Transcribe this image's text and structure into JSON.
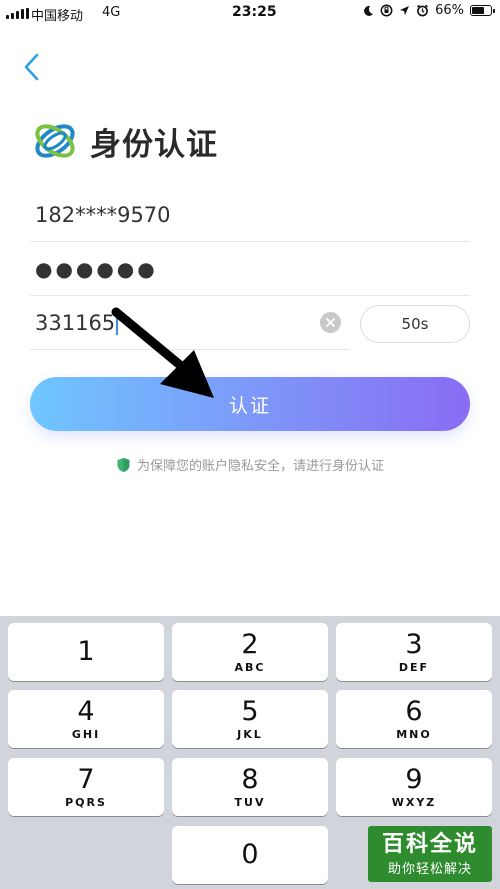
{
  "status_bar": {
    "carrier": "中国移动",
    "network": "4G",
    "time": "23:25",
    "battery_percent": "66%",
    "battery_level": 0.66,
    "icons": [
      "signal-icon",
      "moon-icon",
      "rotation-lock-icon",
      "location-icon",
      "alarm-icon",
      "battery-icon"
    ]
  },
  "nav": {
    "back_icon": "chevron-left-icon"
  },
  "header": {
    "title": "身份认证",
    "logo": "china-mobile-logo"
  },
  "form": {
    "phone_value": "182****9570",
    "password_value": "●●●●●●",
    "code_value": "331165",
    "clear_icon": "clear-icon",
    "countdown_label": "50s",
    "submit_label": "认证",
    "notice": "为保障您的账户隐私安全，请进行身份认证",
    "notice_icon": "shield-icon"
  },
  "keyboard": {
    "keys": [
      {
        "num": "1",
        "letters": ""
      },
      {
        "num": "2",
        "letters": "ABC"
      },
      {
        "num": "3",
        "letters": "DEF"
      },
      {
        "num": "4",
        "letters": "GHI"
      },
      {
        "num": "5",
        "letters": "JKL"
      },
      {
        "num": "6",
        "letters": "MNO"
      },
      {
        "num": "7",
        "letters": "PQRS"
      },
      {
        "num": "8",
        "letters": "TUV"
      },
      {
        "num": "9",
        "letters": "WXYZ"
      },
      {
        "num": "0",
        "letters": ""
      }
    ]
  },
  "watermark": {
    "title": "百科全说",
    "subtitle": "助你轻松解决"
  },
  "colors": {
    "accent": "#2fa0e0",
    "gradient_start": "#6fc6ff",
    "gradient_end": "#8a6cf3",
    "shield_green": "#3cb371",
    "keyboard_bg": "#d1d5db"
  }
}
